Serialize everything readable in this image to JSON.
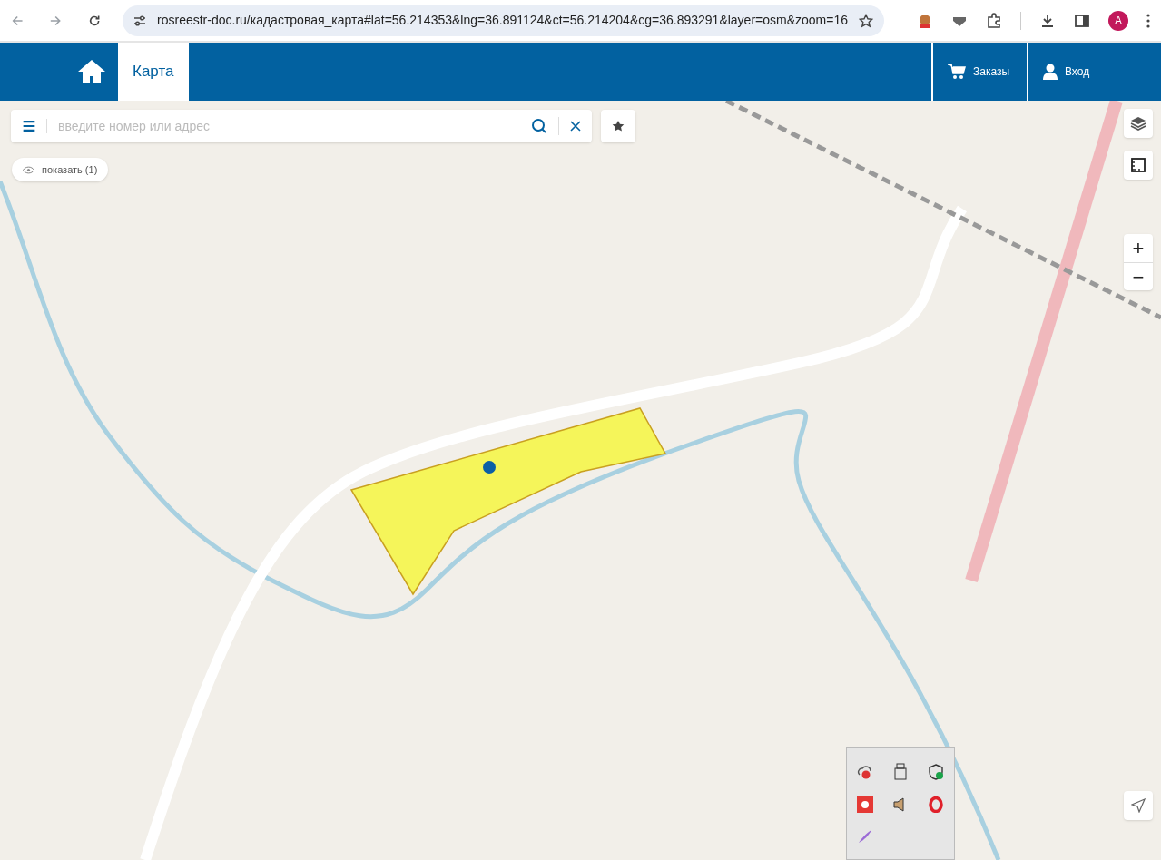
{
  "browser": {
    "url": "rosreestr-doc.ru/кадастровая_карта#lat=56.214353&lng=36.891124&ct=56.214204&cg=36.893291&layer=osm&zoom=16",
    "profile_letter": "A"
  },
  "header": {
    "tabs": [
      {
        "label": "Карта",
        "selected": true
      }
    ],
    "actions": [
      {
        "kind": "cart",
        "label": "Заказы"
      },
      {
        "kind": "user",
        "label": "Вход"
      }
    ]
  },
  "search": {
    "placeholder": "введите номер или адрес"
  },
  "show_button": "показать (1)",
  "map_controls": [
    "+",
    "−"
  ]
}
